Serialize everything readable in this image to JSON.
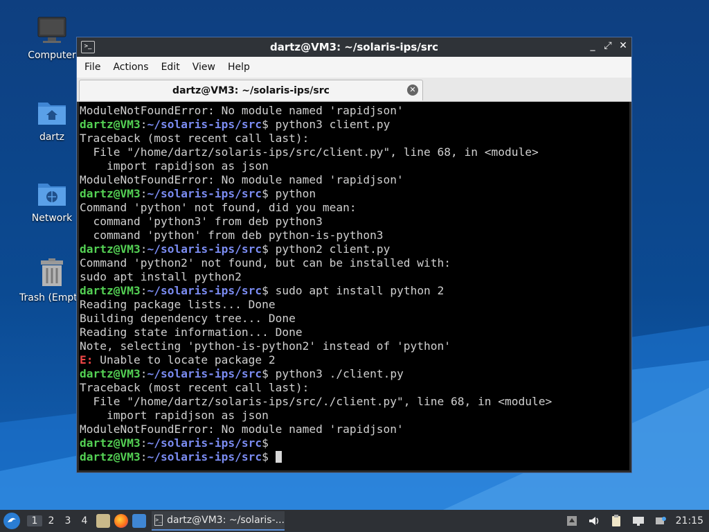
{
  "desktop": {
    "icons": [
      {
        "label": "Computer",
        "icon": "computer-icon"
      },
      {
        "label": "dartz",
        "icon": "home-folder-icon"
      },
      {
        "label": "Network",
        "icon": "network-folder-icon"
      },
      {
        "label": "Trash (Empty)",
        "icon": "trash-icon"
      }
    ]
  },
  "window": {
    "title": "dartz@VM3: ~/solaris-ips/src",
    "controls": {
      "minimize": "_",
      "maximize": "⤢",
      "close": "✕"
    },
    "menu": [
      "File",
      "Actions",
      "Edit",
      "View",
      "Help"
    ],
    "tab_title": "dartz@VM3: ~/solaris-ips/src",
    "tab_close": "✕"
  },
  "terminal": {
    "prompt_user": "dartz@VM3",
    "prompt_sep": ":",
    "prompt_path": "~/solaris-ips/src",
    "prompt_end": "$ ",
    "lines": [
      {
        "type": "out",
        "text": "ModuleNotFoundError: No module named 'rapidjson'"
      },
      {
        "type": "cmd",
        "text": "python3 client.py"
      },
      {
        "type": "out",
        "text": "Traceback (most recent call last):"
      },
      {
        "type": "out",
        "text": "  File \"/home/dartz/solaris-ips/src/client.py\", line 68, in <module>"
      },
      {
        "type": "out",
        "text": "    import rapidjson as json"
      },
      {
        "type": "out",
        "text": "ModuleNotFoundError: No module named 'rapidjson'"
      },
      {
        "type": "cmd",
        "text": "python"
      },
      {
        "type": "out",
        "text": "Command 'python' not found, did you mean:"
      },
      {
        "type": "out",
        "text": "  command 'python3' from deb python3"
      },
      {
        "type": "out",
        "text": "  command 'python' from deb python-is-python3"
      },
      {
        "type": "cmd",
        "text": "python2 client.py"
      },
      {
        "type": "out",
        "text": "Command 'python2' not found, but can be installed with:"
      },
      {
        "type": "out",
        "text": "sudo apt install python2"
      },
      {
        "type": "cmd",
        "text": "sudo apt install python 2"
      },
      {
        "type": "out",
        "text": "Reading package lists... Done"
      },
      {
        "type": "out",
        "text": "Building dependency tree... Done"
      },
      {
        "type": "out",
        "text": "Reading state information... Done"
      },
      {
        "type": "out",
        "text": "Note, selecting 'python-is-python2' instead of 'python'"
      },
      {
        "type": "err",
        "prefix": "E:",
        "text": " Unable to locate package 2"
      },
      {
        "type": "cmd",
        "text": "python3 ./client.py"
      },
      {
        "type": "out",
        "text": "Traceback (most recent call last):"
      },
      {
        "type": "out",
        "text": "  File \"/home/dartz/solaris-ips/src/./client.py\", line 68, in <module>"
      },
      {
        "type": "out",
        "text": "    import rapidjson as json"
      },
      {
        "type": "out",
        "text": "ModuleNotFoundError: No module named 'rapidjson'"
      },
      {
        "type": "cmd",
        "text": ""
      },
      {
        "type": "cmd",
        "text": "",
        "cursor": true
      }
    ]
  },
  "taskbar": {
    "workspaces": [
      "1",
      "2",
      "3",
      "4"
    ],
    "active_workspace": "1",
    "task_label": "dartz@VM3: ~/solaris-...",
    "clock": "21:15"
  }
}
